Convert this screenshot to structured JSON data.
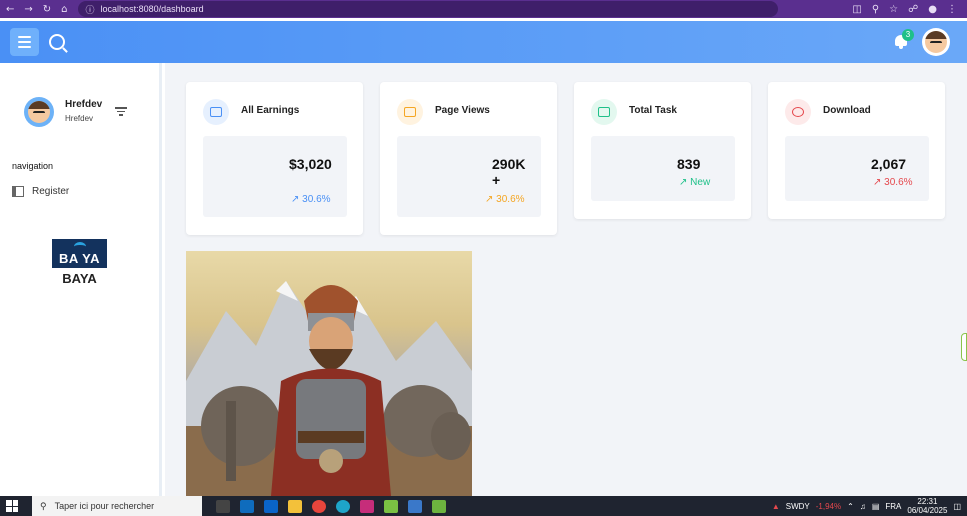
{
  "browser": {
    "url": "localhost:8080/dashboard"
  },
  "header": {
    "notification_count": "3"
  },
  "sidebar": {
    "user_name": "Hrefdev",
    "user_role": "Hrefdev",
    "nav_label": "navigation",
    "items": [
      {
        "label": "Register",
        "icon": "register-icon"
      }
    ],
    "logo_text": "BA YA",
    "brand_name": "BAYA"
  },
  "cards": [
    {
      "title": "All Earnings",
      "value": "$3,020",
      "change": "30.6%",
      "color": "#4a90f5",
      "icon": "wallet-icon"
    },
    {
      "title": "Page Views",
      "value": "290K+",
      "change": "30.6%",
      "color": "#f5a623",
      "icon": "document-icon"
    },
    {
      "title": "Total Task",
      "value": "839",
      "change": "New",
      "color": "#1fc089",
      "icon": "calendar-icon"
    },
    {
      "title": "Download",
      "value": "2,067",
      "change": "30.6%",
      "color": "#e5484d",
      "icon": "download-icon"
    }
  ],
  "taskbar": {
    "search_placeholder": "Taper ici pour rechercher",
    "stock_symbol": "SWDY",
    "stock_change": "-1,94%",
    "language": "FRA",
    "time": "22:31",
    "date": "06/04/2025"
  }
}
